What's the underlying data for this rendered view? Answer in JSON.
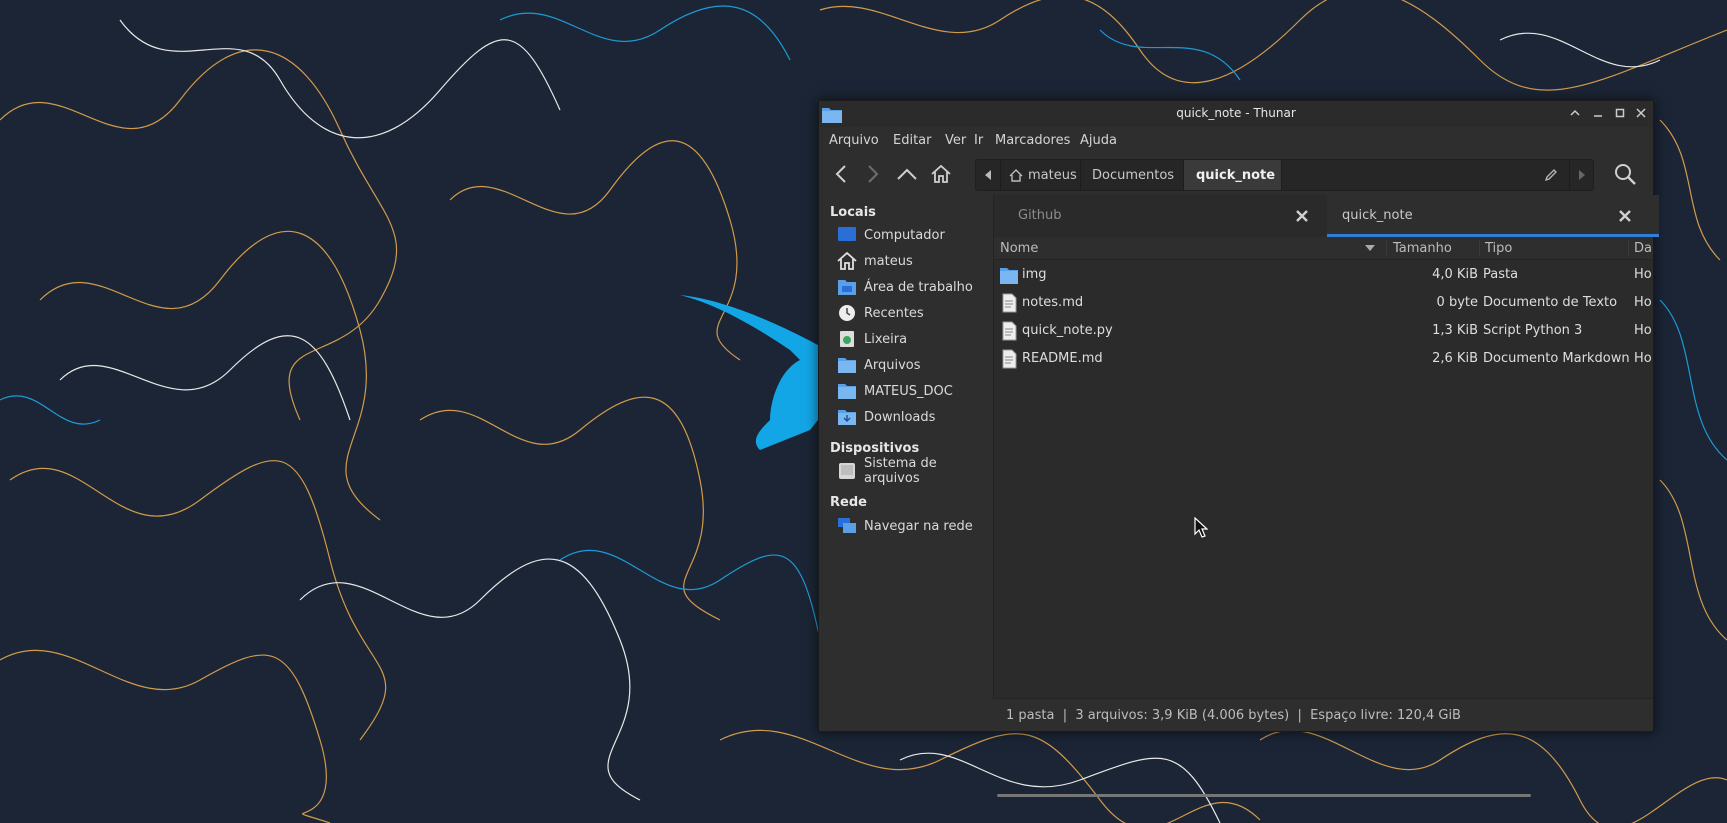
{
  "window": {
    "title": "quick_note - Thunar",
    "controls": [
      "shade",
      "minimize",
      "maximize",
      "close"
    ]
  },
  "menu": [
    "Arquivo",
    "Editar",
    "Ver",
    "Ir",
    "Marcadores",
    "Ajuda"
  ],
  "toolbar": {
    "buttons": [
      "back-icon",
      "forward-icon",
      "up-icon",
      "home-icon"
    ],
    "path": [
      "mateus",
      "Documentos",
      "quick_note"
    ]
  },
  "sidebar": {
    "places_heading": "Locais",
    "places": [
      {
        "label": "Computador",
        "icon": "computer-icon"
      },
      {
        "label": "mateus",
        "icon": "home-icon"
      },
      {
        "label": "Área de trabalho",
        "icon": "desktop-folder-icon"
      },
      {
        "label": "Recentes",
        "icon": "clock-icon"
      },
      {
        "label": "Lixeira",
        "icon": "trash-icon"
      },
      {
        "label": "Arquivos",
        "icon": "folder-icon"
      },
      {
        "label": "MATEUS_DOC",
        "icon": "folder-icon"
      },
      {
        "label": "Downloads",
        "icon": "downloads-folder-icon"
      }
    ],
    "devices_heading": "Dispositivos",
    "devices": [
      {
        "label": "Sistema de arquivos",
        "icon": "drive-icon"
      }
    ],
    "network_heading": "Rede",
    "network": [
      {
        "label": "Navegar na rede",
        "icon": "network-icon"
      }
    ]
  },
  "tabs": [
    {
      "label": "Github",
      "active": false
    },
    {
      "label": "quick_note",
      "active": true
    }
  ],
  "columns": {
    "name": "Nome",
    "size": "Tamanho",
    "type": "Tipo",
    "date": "Da"
  },
  "files": [
    {
      "name": "img",
      "size": "4,0 KiB",
      "type": "Pasta",
      "date": "Ho",
      "kind": "folder"
    },
    {
      "name": "notes.md",
      "size": "0 byte",
      "type": "Documento de Texto",
      "date": "Ho",
      "kind": "file"
    },
    {
      "name": "quick_note.py",
      "size": "1,3 KiB",
      "type": "Script Python 3",
      "date": "Ho",
      "kind": "file"
    },
    {
      "name": "README.md",
      "size": "2,6 KiB",
      "type": "Documento Markdown",
      "date": "Ho",
      "kind": "file"
    }
  ],
  "status": "1 pasta  |  3 arquivos: 3,9 KiB (4.006 bytes)  |  Espaço livre: 120,4 GiB",
  "colors": {
    "accent": "#2f7ed8",
    "folder": "#5aa0e6",
    "wallpaper": "#1b2535"
  }
}
